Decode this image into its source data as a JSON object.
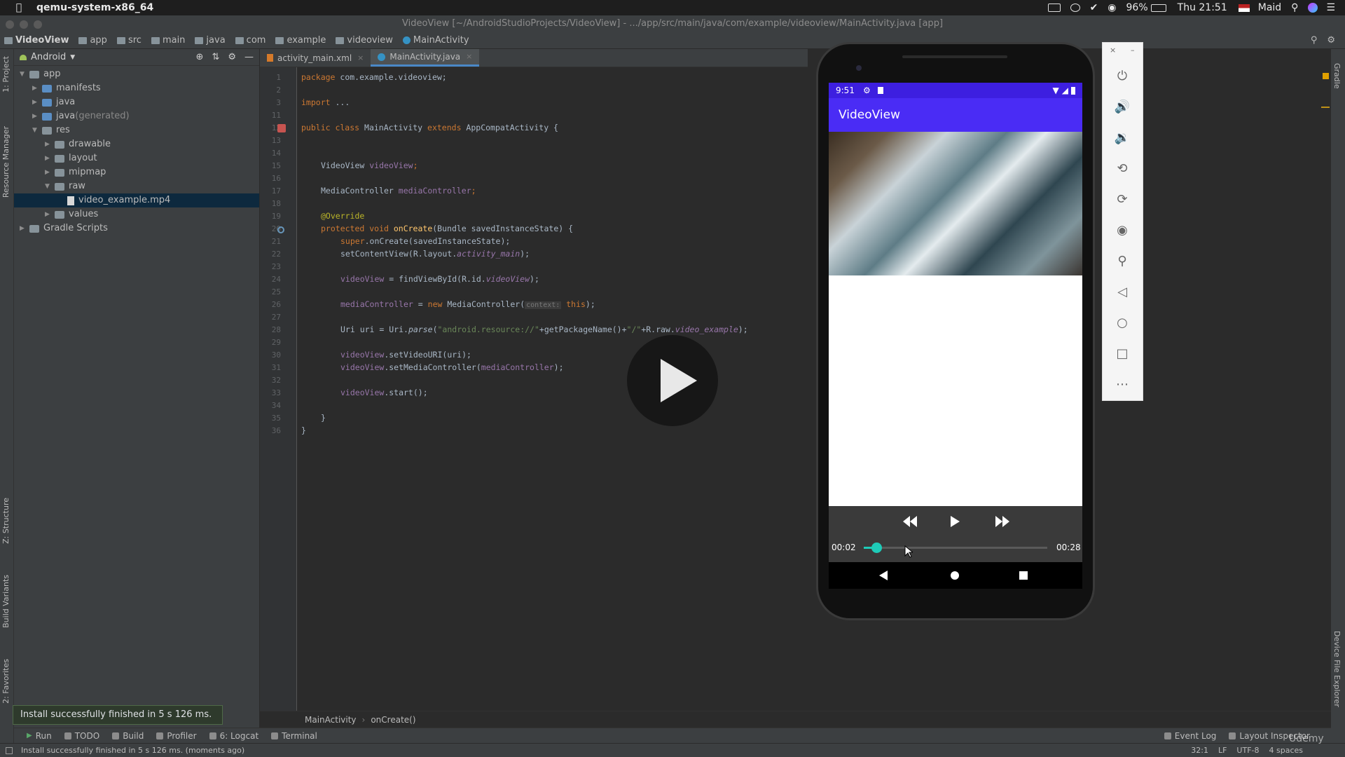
{
  "mac": {
    "app_name": "qemu-system-x86_64",
    "battery": "96%",
    "time": "Thu 21:51",
    "user": "Maid"
  },
  "window": {
    "title": "VideoView [~/AndroidStudioProjects/VideoView] - .../app/src/main/java/com/example/videoview/MainActivity.java [app]"
  },
  "breadcrumb": [
    "VideoView",
    "app",
    "src",
    "main",
    "java",
    "com",
    "example",
    "videoview",
    "MainActivity"
  ],
  "project": {
    "view_label": "Android",
    "tree": [
      {
        "label": "app",
        "indent": 0,
        "arrow": "▼",
        "icon": "folder"
      },
      {
        "label": "manifests",
        "indent": 1,
        "arrow": "▶",
        "icon": "folder"
      },
      {
        "label": "java",
        "indent": 1,
        "arrow": "▶",
        "icon": "folder"
      },
      {
        "label": "java",
        "suffix": " (generated)",
        "indent": 1,
        "arrow": "▶",
        "icon": "folder"
      },
      {
        "label": "res",
        "indent": 1,
        "arrow": "▼",
        "icon": "folder"
      },
      {
        "label": "drawable",
        "indent": 2,
        "arrow": "▶",
        "icon": "folder"
      },
      {
        "label": "layout",
        "indent": 2,
        "arrow": "▶",
        "icon": "folder"
      },
      {
        "label": "mipmap",
        "indent": 2,
        "arrow": "▶",
        "icon": "folder"
      },
      {
        "label": "raw",
        "indent": 2,
        "arrow": "▼",
        "icon": "folder"
      },
      {
        "label": "video_example.mp4",
        "indent": 3,
        "arrow": "",
        "icon": "file",
        "selected": true
      },
      {
        "label": "values",
        "indent": 2,
        "arrow": "▶",
        "icon": "folder"
      },
      {
        "label": "Gradle Scripts",
        "indent": 0,
        "arrow": "▶",
        "icon": "gradle"
      }
    ]
  },
  "left_tool_tabs": [
    "1: Project",
    "Resource Manager",
    "Z: Structure",
    "Build Variants",
    "2: Favorites"
  ],
  "right_tool_tabs": [
    "Gradle",
    "Device File Explorer"
  ],
  "editor_tabs": [
    {
      "label": "activity_main.xml",
      "active": false
    },
    {
      "label": "MainActivity.java",
      "active": true
    }
  ],
  "line_numbers": [
    "1",
    "2",
    "3",
    "11",
    "12",
    "13",
    "14",
    "15",
    "16",
    "17",
    "18",
    "19",
    "20",
    "21",
    "22",
    "23",
    "24",
    "25",
    "26",
    "27",
    "28",
    "29",
    "30",
    "31",
    "32",
    "33",
    "34",
    "35",
    "36"
  ],
  "code": {
    "l1": [
      "package",
      " com.example.videoview;"
    ],
    "l3": [
      "import",
      " ..."
    ],
    "l12": [
      "public class",
      " MainActivity ",
      "extends",
      " AppCompatActivity {"
    ],
    "l15": [
      "VideoView ",
      "videoView",
      ";"
    ],
    "l17": [
      "MediaController ",
      "mediaController",
      ";"
    ],
    "l19": "@Override",
    "l20": [
      "protected void ",
      "onCreate",
      "(Bundle savedInstanceState) {"
    ],
    "l21": [
      "super",
      ".onCreate(savedInstanceState);"
    ],
    "l22": [
      "setContentView(R.layout.",
      "activity_main",
      ");"
    ],
    "l24": [
      "videoView",
      " = findViewById(R.id.",
      "videoView",
      ");"
    ],
    "l26": [
      "mediaController",
      " = ",
      "new",
      " MediaController(",
      "context:",
      " this",
      ");"
    ],
    "l28": [
      "Uri uri = Uri.",
      "parse",
      "(",
      "\"android.resource://\"",
      "+getPackageName()+",
      "\"/\"",
      "+R.raw.",
      "video_example",
      ");"
    ],
    "l30": [
      "videoView",
      ".setVideoURI(uri);"
    ],
    "l31": [
      "videoView",
      ".setMediaController(",
      "mediaController",
      ");"
    ],
    "l33": [
      "videoView",
      ".start();"
    ],
    "l35": "}",
    "l36": "}"
  },
  "editor_breadcrumb": [
    "MainActivity",
    "onCreate()"
  ],
  "bottom_tabs": [
    "Run",
    "TODO",
    "Build",
    "Profiler",
    "6: Logcat",
    "Terminal"
  ],
  "bottom_right_tabs": [
    "Event Log",
    "Layout Inspector"
  ],
  "toast": "Install successfully finished in 5 s 126 ms.",
  "status": {
    "message": "Install successfully finished in 5 s 126 ms. (moments ago)",
    "position": "32:1",
    "line_sep": "LF",
    "encoding": "UTF-8",
    "indent": "4 spaces"
  },
  "phone": {
    "time": "9:51",
    "app_title": "VideoView",
    "elapsed": "00:02",
    "duration": "00:28",
    "progress_fraction": 0.07
  },
  "watermark": "Udemy"
}
